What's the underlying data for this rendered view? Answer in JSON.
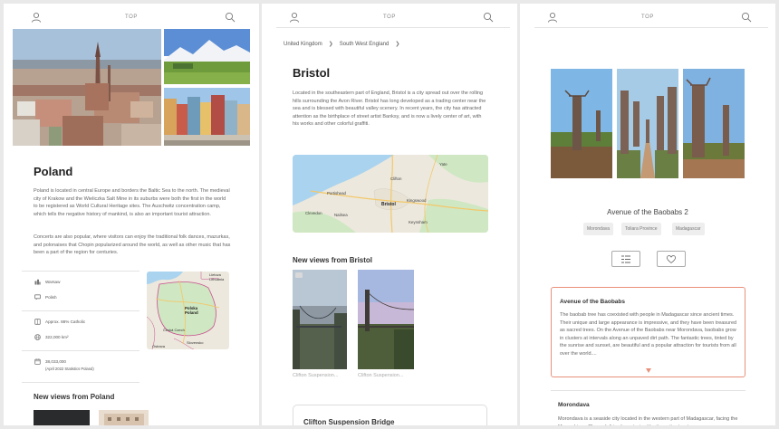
{
  "nav": {
    "top_label": "TOP"
  },
  "poland": {
    "title": "Poland",
    "description": "Poland is located in central Europe and borders the Baltic Sea to the north. The medieval city of Krakow and the Wieliczka Salt Mine in its suburbs were both the first in the world to be registered as World Cultural Heritage sites. The Auschwitz concentration camp, which tells the negative history of mankind, is also an important tourist attraction.",
    "description2": "Concerts are also popular, where visitors can enjoy the traditional folk dances, mazurkas, and polonaises that Chopin popularized around the world, as well as other music that has been a part of the region for centuries.",
    "facts": {
      "capital": "Warsaw",
      "language": "Polish",
      "religion": "Approx. 88% Catholic",
      "area": "322,000 km²",
      "population": "38,033,000",
      "population_note": "(April 2022 Statistics Poland)"
    },
    "map_labels": {
      "lietuva": "Lietuva Lithuania",
      "polska": "Polska Poland",
      "ceska": "Česká Czech",
      "slovensko": "Slovensko",
      "ostrava": "Ostrava"
    },
    "new_views_heading": "New views from Poland"
  },
  "bristol": {
    "breadcrumb": [
      "United Kingdom",
      "South West England"
    ],
    "title": "Bristol",
    "description": "Located in the southeastern part of England, Bristol is a city spread out over the rolling hills surrounding the Avon River. Bristol has long developed as a trading center near the sea and is blessed with beautiful valley scenery. In recent years, the city has attracted attention as the birthplace of street artist Banksy, and is now a lively center of art, with his works and other colorful graffiti.",
    "map_labels": {
      "clifton": "Clifton",
      "portishead": "Portishead",
      "bristol": "Bristol",
      "kingswood": "Kingswood",
      "clevedon": "Clevedon",
      "nailsea": "Nailsea",
      "keynsham": "Keynsham",
      "yate": "Yate"
    },
    "new_views_heading": "New views from Bristol",
    "views": [
      {
        "caption": "Clifton Suspension..."
      },
      {
        "caption": "Clifton Suspension..."
      }
    ],
    "card_title": "Clifton Suspension Bridge"
  },
  "baobab": {
    "gallery_title": "Avenue of the Baobabs 2",
    "tags": [
      "Morondava",
      "Toliara Province",
      "Madagascar"
    ],
    "box_title": "Avenue of the Baobabs",
    "box_text": "The baobab tree has coexisted with people in Madagascar since ancient times. Their unique and large appearance is impressive, and they have been treasured as sacred trees. On the Avenue of the Baobabs near Morondava, baobabs grow in clusters at intervals along an unpaved dirt path. The fantastic trees, tinted by the sunrise and sunset, are beautiful and a popular attraction for tourists from all over the world....",
    "next_title": "Morondava",
    "next_text": "Morondava is a seaside city located in the western part of Madagascar, facing the Mozambique Channel. It is characterized by its rustic streets."
  },
  "colors": {
    "accent": "#e8917a",
    "map_land": "#ece8dd",
    "map_water": "#a9d3ef",
    "map_green": "#cfe7c2"
  }
}
